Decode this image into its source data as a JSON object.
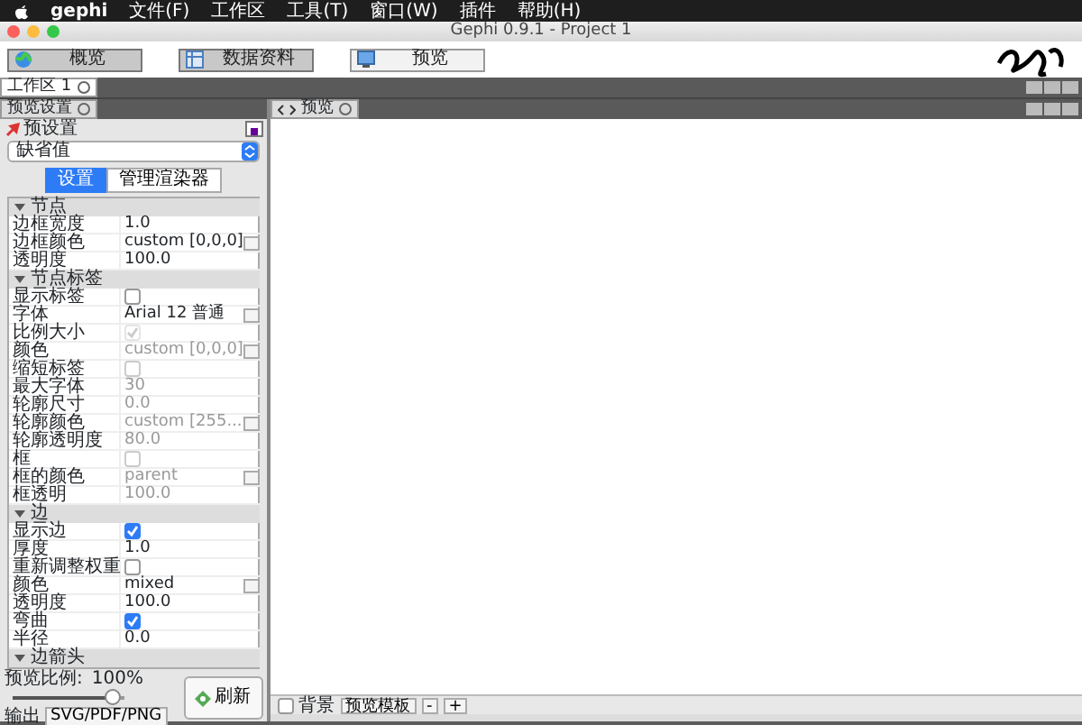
{
  "menubar": {
    "items": [
      "gephi",
      "文件(F)",
      "工作区",
      "工具(T)",
      "窗口(W)",
      "插件",
      "帮助(H)"
    ]
  },
  "window": {
    "title": "Gephi 0.9.1 - Project 1"
  },
  "toolbar": [
    {
      "label": "概览",
      "selected": false,
      "kind": "globe"
    },
    {
      "label": "数据资料",
      "selected": false,
      "kind": "table"
    },
    {
      "label": "预览",
      "selected": true,
      "kind": "monitor"
    }
  ],
  "workspace_tabs": [
    {
      "label": "工作区 1",
      "selected": true
    }
  ],
  "left_panel": {
    "tab": "预览设置",
    "preset": {
      "label": "预设置",
      "value": "缺省值"
    },
    "tabs": [
      {
        "label": "设置",
        "selected": true
      },
      {
        "label": "管理渲染器",
        "selected": false
      }
    ],
    "sections": [
      {
        "title": "节点",
        "expanded": true,
        "rows": [
          {
            "name": "边框宽度",
            "kind": "text",
            "value": "1.0",
            "disabled": false,
            "button": false
          },
          {
            "name": "边框颜色",
            "kind": "text",
            "value": "custom [0,0,0]",
            "disabled": false,
            "button": true
          },
          {
            "name": "透明度",
            "kind": "text",
            "value": "100.0",
            "disabled": false,
            "button": false
          }
        ]
      },
      {
        "title": "节点标签",
        "expanded": true,
        "rows": [
          {
            "name": "显示标签",
            "kind": "check",
            "checked": false,
            "disabled": false
          },
          {
            "name": "字体",
            "kind": "text",
            "value": "Arial 12 普通",
            "disabled": false,
            "button": true
          },
          {
            "name": "比例大小",
            "kind": "check",
            "checked": true,
            "disabled": true
          },
          {
            "name": "颜色",
            "kind": "text",
            "value": "custom [0,0,0]",
            "disabled": true,
            "button": true
          },
          {
            "name": "缩短标签",
            "kind": "check",
            "checked": false,
            "disabled": true
          },
          {
            "name": "最大字体",
            "kind": "text",
            "value": "30",
            "disabled": true,
            "button": false
          },
          {
            "name": "轮廓尺寸",
            "kind": "text",
            "value": "0.0",
            "disabled": true,
            "button": false
          },
          {
            "name": "轮廓颜色",
            "kind": "text",
            "value": "custom [255...",
            "disabled": true,
            "button": true
          },
          {
            "name": "轮廓透明度",
            "kind": "text",
            "value": "80.0",
            "disabled": true,
            "button": false
          },
          {
            "name": "框",
            "kind": "check",
            "checked": false,
            "disabled": true
          },
          {
            "name": "框的颜色",
            "kind": "text",
            "value": "parent",
            "disabled": true,
            "button": true
          },
          {
            "name": "框透明",
            "kind": "text",
            "value": "100.0",
            "disabled": true,
            "button": false
          }
        ]
      },
      {
        "title": "边",
        "expanded": true,
        "rows": [
          {
            "name": "显示边",
            "kind": "check",
            "checked": true,
            "disabled": false
          },
          {
            "name": "厚度",
            "kind": "text",
            "value": "1.0",
            "disabled": false,
            "button": false
          },
          {
            "name": "重新调整权重",
            "kind": "check",
            "checked": false,
            "disabled": false
          },
          {
            "name": "颜色",
            "kind": "text",
            "value": "mixed",
            "disabled": false,
            "button": true
          },
          {
            "name": "透明度",
            "kind": "text",
            "value": "100.0",
            "disabled": false,
            "button": false
          },
          {
            "name": "弯曲",
            "kind": "check",
            "checked": true,
            "disabled": false
          },
          {
            "name": "半径",
            "kind": "text",
            "value": "0.0",
            "disabled": false,
            "button": false
          }
        ]
      },
      {
        "title": "边箭头",
        "expanded": true
      }
    ],
    "ratio": {
      "label": "预览比例:",
      "value": "100%",
      "level": 0.9
    },
    "refresh": "刷新",
    "export": {
      "label": "输出",
      "button": "SVG/PDF/PNG"
    }
  },
  "preview": {
    "tab": "预览",
    "background": {
      "label": "背景",
      "checked": false
    },
    "template_button": "预览模板",
    "zoom_buttons": [
      "-",
      "+"
    ]
  }
}
